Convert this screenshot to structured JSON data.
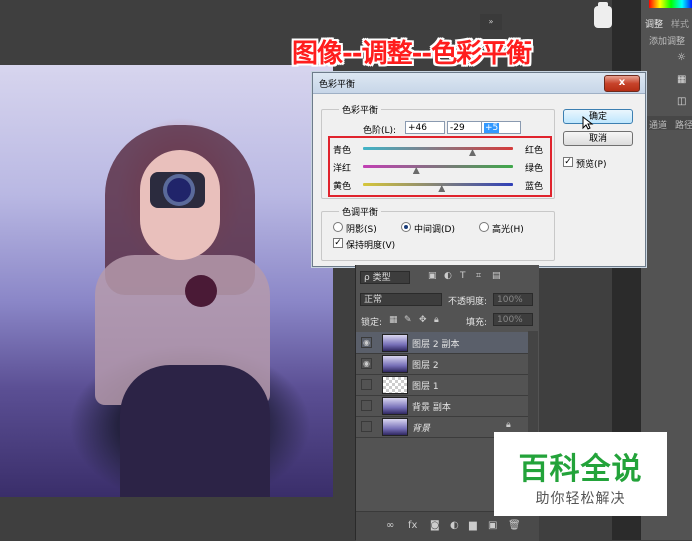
{
  "caption": "图像--调整--色彩平衡",
  "right_panel": {
    "tab_adjust": "调整",
    "tab_style": "样式",
    "add_adjust": "添加调整",
    "sub_channel": "通道",
    "sub_path": "路径"
  },
  "mini_panel": "»",
  "dialog": {
    "title": "色彩平衡",
    "close": "x",
    "balance_group": "色彩平衡",
    "levels_label": "色阶(L):",
    "levels": [
      "+46",
      "-29",
      "+5"
    ],
    "sliders": [
      {
        "left": "青色",
        "right": "红色",
        "value": 46
      },
      {
        "left": "洋红",
        "right": "绿色",
        "value": -29
      },
      {
        "left": "黄色",
        "right": "蓝色",
        "value": 5
      }
    ],
    "tone_group": "色调平衡",
    "tones": [
      {
        "label": "阴影(S)",
        "checked": false
      },
      {
        "label": "中间调(D)",
        "checked": true
      },
      {
        "label": "高光(H)",
        "checked": false
      }
    ],
    "preserve_luminosity": "保持明度(V)",
    "ok": "确定",
    "cancel": "取消",
    "preview": "预览(P)",
    "colors": {
      "cyan_red": "#d53b3b",
      "magenta_green": "#3fa84a",
      "yellow_blue": "#2f3fb8",
      "highlight_box": "#e0232d"
    }
  },
  "layers_panel": {
    "filter_kind": "ρ 类型",
    "blend_mode": "正常",
    "opacity_label": "不透明度:",
    "opacity_value": "100%",
    "lock_label": "锁定:",
    "fill_label": "填充:",
    "fill_value": "100%",
    "layers": [
      {
        "name": "图层 2 副本",
        "visible": true,
        "active": true,
        "thumb": "image"
      },
      {
        "name": "图层 2",
        "visible": true,
        "active": false,
        "thumb": "image"
      },
      {
        "name": "图层 1",
        "visible": false,
        "active": false,
        "thumb": "transparent"
      },
      {
        "name": "背景 副本",
        "visible": false,
        "active": false,
        "thumb": "image"
      },
      {
        "name": "背景",
        "visible": false,
        "active": false,
        "thumb": "image",
        "locked": true
      }
    ],
    "bottom_icons": [
      "∞",
      "fx",
      "◙",
      "◐",
      "▆",
      "▣",
      "🗑"
    ]
  },
  "watermark": {
    "big": "百科全说",
    "small": "助你轻松解决"
  }
}
